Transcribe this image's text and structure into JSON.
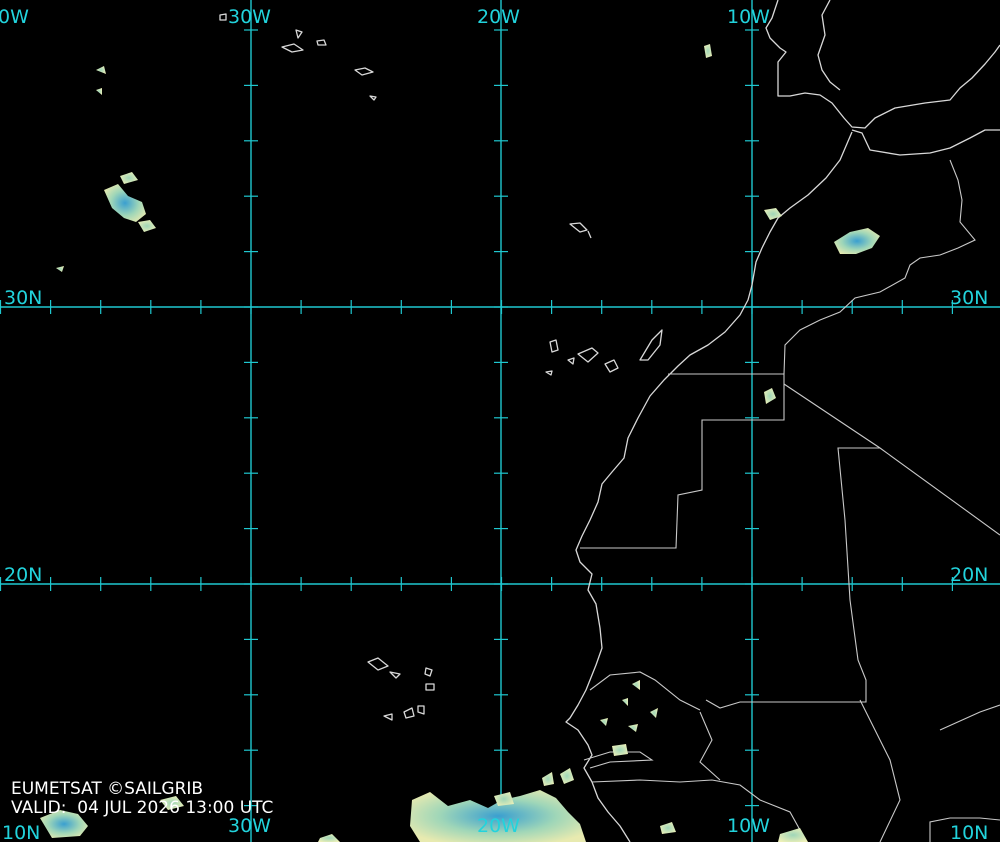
{
  "credits": {
    "source": "EUMETSAT ©SAILGRIB",
    "valid": "VALID:  04 JUL 2026 13:00 UTC"
  },
  "labels": {
    "lon_40w_top": "0W",
    "lon_30w_top": "30W",
    "lon_20w_top": "20W",
    "lon_10w_top": "10W",
    "lon_40w_bottom": "10N",
    "lon_30w_bottom": "30W",
    "lon_20w_bottom": "20W",
    "lon_10w_bottom": "10W",
    "lat_30n_left": "30N",
    "lat_30n_right": "30N",
    "lat_20n_left": "20N",
    "lat_20n_right": "20N",
    "lat_10n_right": "10N"
  },
  "colors": {
    "background": "#000000",
    "graticule": "#1fc7cf",
    "coastline": "#d8d8d8",
    "cloud_light": "#e8eab0",
    "cloud_mid": "#9fd6b8",
    "cloud_deep": "#3a9fd0"
  }
}
